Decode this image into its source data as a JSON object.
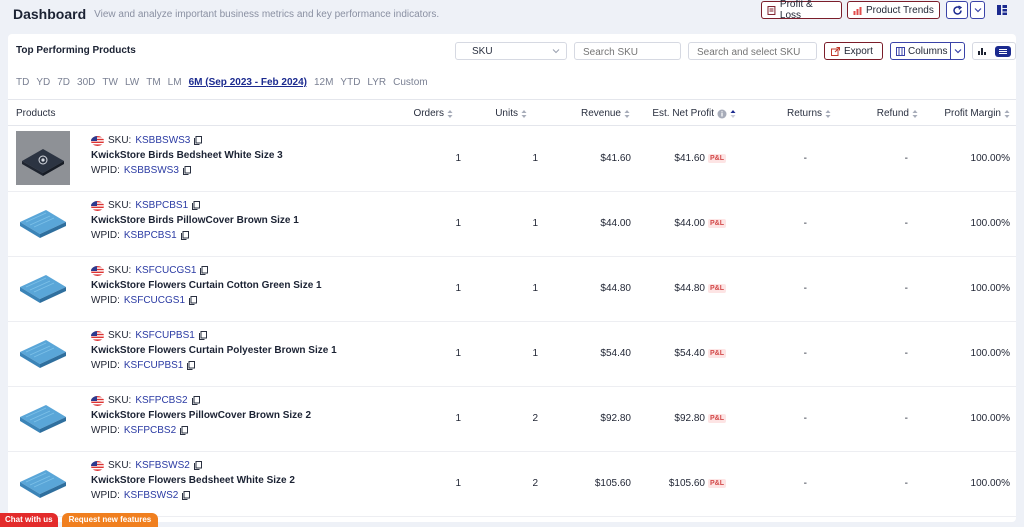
{
  "header": {
    "title": "Dashboard",
    "subtitle": "View and analyze important business metrics and key performance indicators.",
    "profit_loss": "Profit & Loss",
    "product_trends": "Product Trends"
  },
  "card": {
    "title": "Top Performing Products",
    "select_value": "SKU",
    "sku_placeholder": "Search SKU",
    "search_placeholder": "Search and select SKU",
    "export_label": "Export",
    "columns_label": "Columns"
  },
  "periods": [
    "TD",
    "YD",
    "7D",
    "30D",
    "TW",
    "LW",
    "TM",
    "LM",
    "6M (Sep 2023 - Feb 2024)",
    "12M",
    "YTD",
    "LYR",
    "Custom"
  ],
  "active_period": "6M (Sep 2023 - Feb 2024)",
  "columns": {
    "products": "Products",
    "orders": "Orders",
    "units": "Units",
    "revenue": "Revenue",
    "net_profit": "Est. Net Profit",
    "returns": "Returns",
    "refund": "Refund",
    "margin": "Profit Margin"
  },
  "labels": {
    "sku": "SKU:",
    "wpid": "WPID:",
    "pl": "P&L"
  },
  "rows": [
    {
      "sku": "KSBBSWS3",
      "name": "KwickStore Birds Bedsheet White Size 3",
      "wpid": "KSBBSWS3",
      "orders": "1",
      "units": "1",
      "revenue": "$41.60",
      "profit": "$41.60",
      "returns": "-",
      "refund": "-",
      "margin": "100.00%"
    },
    {
      "sku": "KSBPCBS1",
      "name": "KwickStore Birds PillowCover Brown Size 1",
      "wpid": "KSBPCBS1",
      "orders": "1",
      "units": "1",
      "revenue": "$44.00",
      "profit": "$44.00",
      "returns": "-",
      "refund": "-",
      "margin": "100.00%"
    },
    {
      "sku": "KSFCUCGS1",
      "name": "KwickStore Flowers Curtain Cotton Green Size 1",
      "wpid": "KSFCUCGS1",
      "orders": "1",
      "units": "1",
      "revenue": "$44.80",
      "profit": "$44.80",
      "returns": "-",
      "refund": "-",
      "margin": "100.00%"
    },
    {
      "sku": "KSFCUPBS1",
      "name": "KwickStore Flowers Curtain Polyester Brown Size 1",
      "wpid": "KSFCUPBS1",
      "orders": "1",
      "units": "1",
      "revenue": "$54.40",
      "profit": "$54.40",
      "returns": "-",
      "refund": "-",
      "margin": "100.00%"
    },
    {
      "sku": "KSFPCBS2",
      "name": "KwickStore Flowers PillowCover Brown Size 2",
      "wpid": "KSFPCBS2",
      "orders": "1",
      "units": "2",
      "revenue": "$92.80",
      "profit": "$92.80",
      "returns": "-",
      "refund": "-",
      "margin": "100.00%"
    },
    {
      "sku": "KSFBSWS2",
      "name": "KwickStore Flowers Bedsheet White Size 2",
      "wpid": "KSFBSWS2",
      "orders": "1",
      "units": "2",
      "revenue": "$105.60",
      "profit": "$105.60",
      "returns": "-",
      "refund": "-",
      "margin": "100.00%"
    }
  ],
  "footer": {
    "chat": "Chat with us",
    "request": "Request new features"
  },
  "colors": {
    "accent": "#3a43a8",
    "brand": "#7b1d2a",
    "chat": "#e32b2b",
    "request": "#f07f1f"
  }
}
